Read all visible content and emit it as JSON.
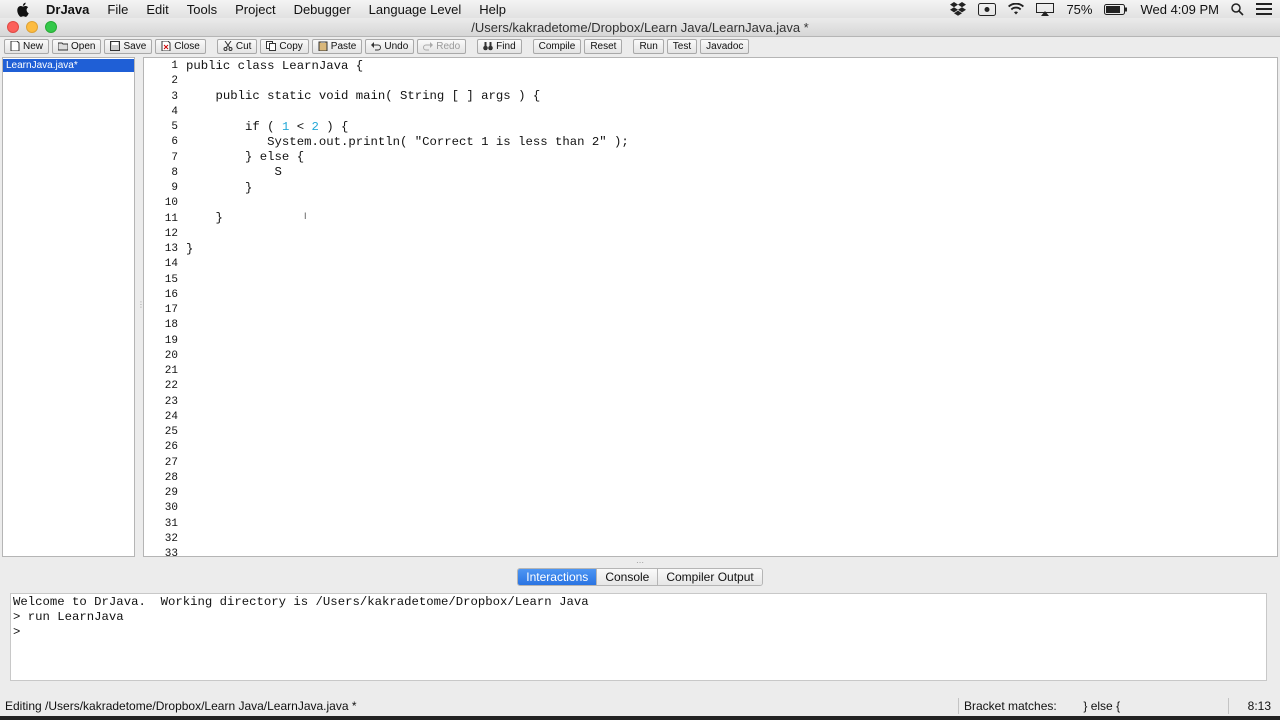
{
  "menubar": {
    "app_name": "DrJava",
    "items": [
      "File",
      "Edit",
      "Tools",
      "Project",
      "Debugger",
      "Language Level",
      "Help"
    ],
    "battery": "75%",
    "clock": "Wed 4:09 PM"
  },
  "window": {
    "title": "/Users/kakradetome/Dropbox/Learn Java/LearnJava.java *"
  },
  "toolbar": {
    "new": "New",
    "open": "Open",
    "save": "Save",
    "close": "Close",
    "cut": "Cut",
    "copy": "Copy",
    "paste": "Paste",
    "undo": "Undo",
    "redo": "Redo",
    "find": "Find",
    "compile": "Compile",
    "reset": "Reset",
    "run": "Run",
    "test": "Test",
    "javadoc": "Javadoc"
  },
  "documents": [
    "LearnJava.java*"
  ],
  "editor": {
    "line_numbers": [
      "1",
      "2",
      "3",
      "4",
      "5",
      "6",
      "7",
      "8",
      "9",
      "10",
      "11",
      "12",
      "13",
      "14",
      "15",
      "16",
      "17",
      "18",
      "19",
      "20",
      "21",
      "22",
      "23",
      "24",
      "25",
      "26",
      "27",
      "28",
      "29",
      "30",
      "31",
      "32",
      "33"
    ],
    "code": {
      "l1": "public class LearnJava {",
      "l3": "    public static void main( String [ ] args ) {",
      "l5_a": "        if ( ",
      "l5_n1": "1",
      "l5_b": " < ",
      "l5_n2": "2",
      "l5_c": " ) {",
      "l6": "           System.out.println( \"Correct 1 is less than 2\" );",
      "l7": "        } else {",
      "l8": "            S",
      "l9": "        }",
      "l11": "    }",
      "l13": "}"
    }
  },
  "tabs": [
    "Interactions",
    "Console",
    "Compiler Output"
  ],
  "interactions": {
    "lines": [
      "Welcome to DrJava.  Working directory is /Users/kakradetome/Dropbox/Learn Java",
      "> run LearnJava",
      ">"
    ]
  },
  "status": {
    "editing": "Editing /Users/kakradetome/Dropbox/Learn Java/LearnJava.java *",
    "bracket": "Bracket matches:        } else {",
    "position": "8:13"
  }
}
